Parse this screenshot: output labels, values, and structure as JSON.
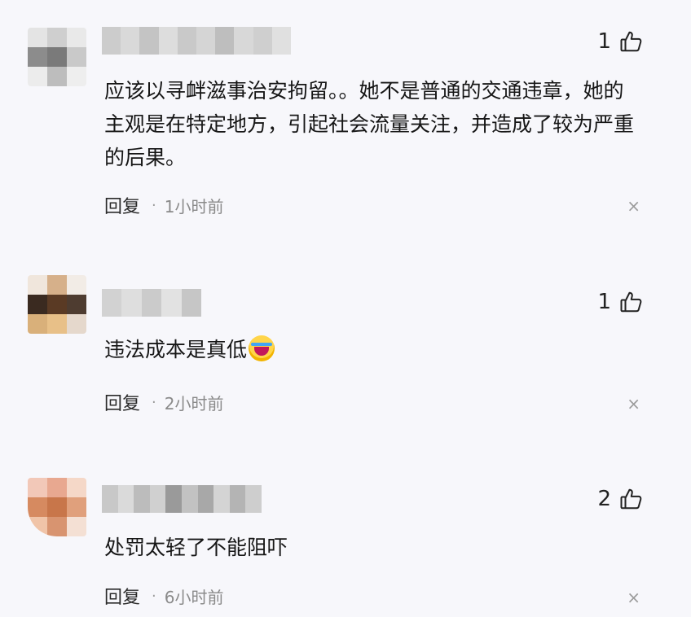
{
  "colors": {
    "background": "#f7f7fb",
    "text": "#161616",
    "meta_time": "#8a8a8a",
    "close_icon": "#9b9b9b"
  },
  "comments": [
    {
      "avatar_pixels": [
        "#e4e4e4",
        "#cfcfcf",
        "#e9e9e9",
        "#8c8c8c",
        "#7a7a7a",
        "#c9c9c9",
        "#ececec",
        "#bdbdbd",
        "#eeeeee"
      ],
      "username_pixels": [
        "#cccccc",
        "#d9d9d9",
        "#c4c4c4",
        "#dddddd",
        "#c9c9c9",
        "#d5d5d5",
        "#bebebe",
        "#d8d8d8",
        "#cfcfcf",
        "#e0e0e0"
      ],
      "likes": "1",
      "like_icon": "thumbs-up-icon",
      "text": "应该以寻衅滋事治安拘留。。她不是普通的交通违章，她的主观是在特定地方，引起社会流量关注，并造成了较为严重的后果。",
      "reply_label": "回复",
      "separator": "·",
      "time": "1小时前",
      "close_icon": "×"
    },
    {
      "avatar_pixels": [
        "#f0e6dc",
        "#d6b08a",
        "#f2ece6",
        "#3a2a20",
        "#5a3a24",
        "#4e3c30",
        "#d9b07a",
        "#e8c088",
        "#e5d8cc"
      ],
      "username_pixels": [
        "#d2d2d2",
        "#dedede",
        "#cbcbcb",
        "#e2e2e2",
        "#c6c6c6"
      ],
      "likes": "1",
      "like_icon": "thumbs-up-icon",
      "text": "违法成本是真低",
      "has_emoji": "laughing-crying-emoji",
      "reply_label": "回复",
      "separator": "·",
      "time": "2小时前",
      "close_icon": "×"
    },
    {
      "avatar_pixels": [
        "#f2c8b8",
        "#e8a890",
        "#f5d8c8",
        "#d68a60",
        "#c8764a",
        "#e0a07c",
        "#f0c4a8",
        "#d89470",
        "#f4e0d4"
      ],
      "username_pixels": [
        "#c8c8c8",
        "#dadada",
        "#bcbcbc",
        "#d0d0d0",
        "#9a9a9a",
        "#c2c2c2",
        "#a8a8a8",
        "#d4d4d4",
        "#b4b4b4",
        "#cecece"
      ],
      "likes": "2",
      "like_icon": "thumbs-up-icon",
      "text": "处罚太轻了不能阻吓",
      "reply_label": "回复",
      "separator": "·",
      "time": "6小时前",
      "close_icon": "×"
    }
  ]
}
